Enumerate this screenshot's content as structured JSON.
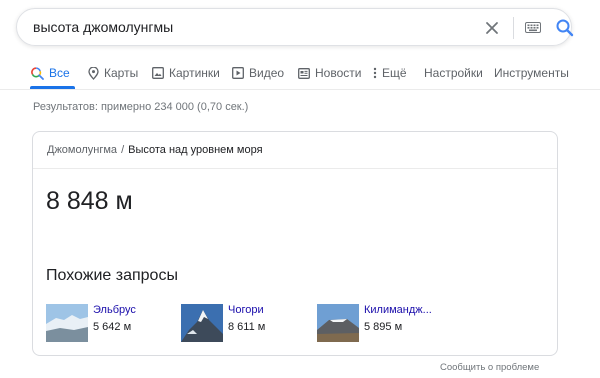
{
  "search": {
    "query": "высота джомолунгмы"
  },
  "tabs": [
    {
      "label": "Все",
      "icon": "search-icon",
      "active": true
    },
    {
      "label": "Карты",
      "icon": "map-pin-icon"
    },
    {
      "label": "Картинки",
      "icon": "image-icon"
    },
    {
      "label": "Видео",
      "icon": "video-icon"
    },
    {
      "label": "Новости",
      "icon": "news-icon"
    },
    {
      "label": "Ещё",
      "icon": "more-icon"
    },
    {
      "label": "Настройки"
    },
    {
      "label": "Инструменты"
    }
  ],
  "stats": "Результатов: примерно 234 000 (0,70 сек.)",
  "card": {
    "breadcrumb_root": "Джомолунгма",
    "breadcrumb_sep": "/",
    "breadcrumb_current": "Высота над уровнем моря",
    "answer": "8 848 м",
    "related_title": "Похожие запросы",
    "related": [
      {
        "name": "Эльбрус",
        "value": "5 642 м"
      },
      {
        "name": "Чогори",
        "value": "8 611 м"
      },
      {
        "name": "Килимандж...",
        "value": "5 895 м"
      }
    ]
  },
  "footer": {
    "report": "Сообщить о проблеме"
  },
  "colors": {
    "accent": "#1a73e8",
    "link": "#1a0dab",
    "muted": "#70757a"
  }
}
